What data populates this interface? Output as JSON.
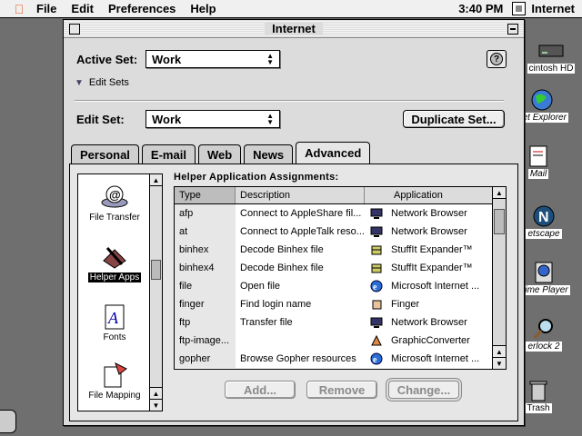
{
  "menubar": {
    "items": [
      "File",
      "Edit",
      "Preferences",
      "Help"
    ],
    "clock": "3:40 PM",
    "app_name": "Internet"
  },
  "desktop_icons": [
    {
      "label": "cintosh HD",
      "icon": "hard-disk-icon"
    },
    {
      "label": "net Explorer",
      "icon": "globe-icon"
    },
    {
      "label": "Mail",
      "icon": "mail-icon"
    },
    {
      "label": "etscape",
      "icon": "netscape-icon"
    },
    {
      "label": "Time Player",
      "icon": "quicktime-icon"
    },
    {
      "label": "erlock 2",
      "icon": "magnifier-icon"
    },
    {
      "label": "Trash",
      "icon": "trash-icon"
    }
  ],
  "window": {
    "title": "Internet",
    "active_set_label": "Active Set:",
    "active_set_value": "Work",
    "edit_sets_label": "Edit Sets",
    "edit_set_label": "Edit Set:",
    "edit_set_value": "Work",
    "duplicate_button": "Duplicate Set...",
    "help_button": "?",
    "tabs": [
      "Personal",
      "E-mail",
      "Web",
      "News",
      "Advanced"
    ],
    "active_tab": "Advanced",
    "categories": [
      {
        "label": "File Transfer",
        "icon": "file-transfer-icon"
      },
      {
        "label": "Helper Apps",
        "icon": "helper-apps-icon"
      },
      {
        "label": "Fonts",
        "icon": "fonts-icon"
      },
      {
        "label": "File Mapping",
        "icon": "file-mapping-icon"
      }
    ],
    "selected_category": "Helper Apps",
    "table_title": "Helper Application Assignments:",
    "columns": [
      "Type",
      "Description",
      "Application"
    ],
    "rows": [
      {
        "type": "afp",
        "description": "Connect to AppleShare fil...",
        "application": "Network Browser",
        "icon": "network-browser-icon"
      },
      {
        "type": "at",
        "description": "Connect to AppleTalk reso...",
        "application": "Network Browser",
        "icon": "network-browser-icon"
      },
      {
        "type": "binhex",
        "description": "Decode Binhex file",
        "application": "StuffIt Expander™",
        "icon": "stuffit-icon"
      },
      {
        "type": "binhex4",
        "description": "Decode Binhex file",
        "application": "StuffIt Expander™",
        "icon": "stuffit-icon"
      },
      {
        "type": "file",
        "description": "Open file",
        "application": "Microsoft Internet ...",
        "icon": "ie-icon"
      },
      {
        "type": "finger",
        "description": "Find login name",
        "application": "Finger",
        "icon": "finger-icon"
      },
      {
        "type": "ftp",
        "description": "Transfer file",
        "application": "Network Browser",
        "icon": "network-browser-icon"
      },
      {
        "type": "ftp-image...",
        "description": "",
        "application": "GraphicConverter",
        "icon": "graphicconverter-icon"
      },
      {
        "type": "gopher",
        "description": "Browse Gopher resources",
        "application": "Microsoft Internet ...",
        "icon": "ie-icon"
      }
    ],
    "buttons": {
      "add": "Add...",
      "remove": "Remove",
      "change": "Change..."
    }
  }
}
